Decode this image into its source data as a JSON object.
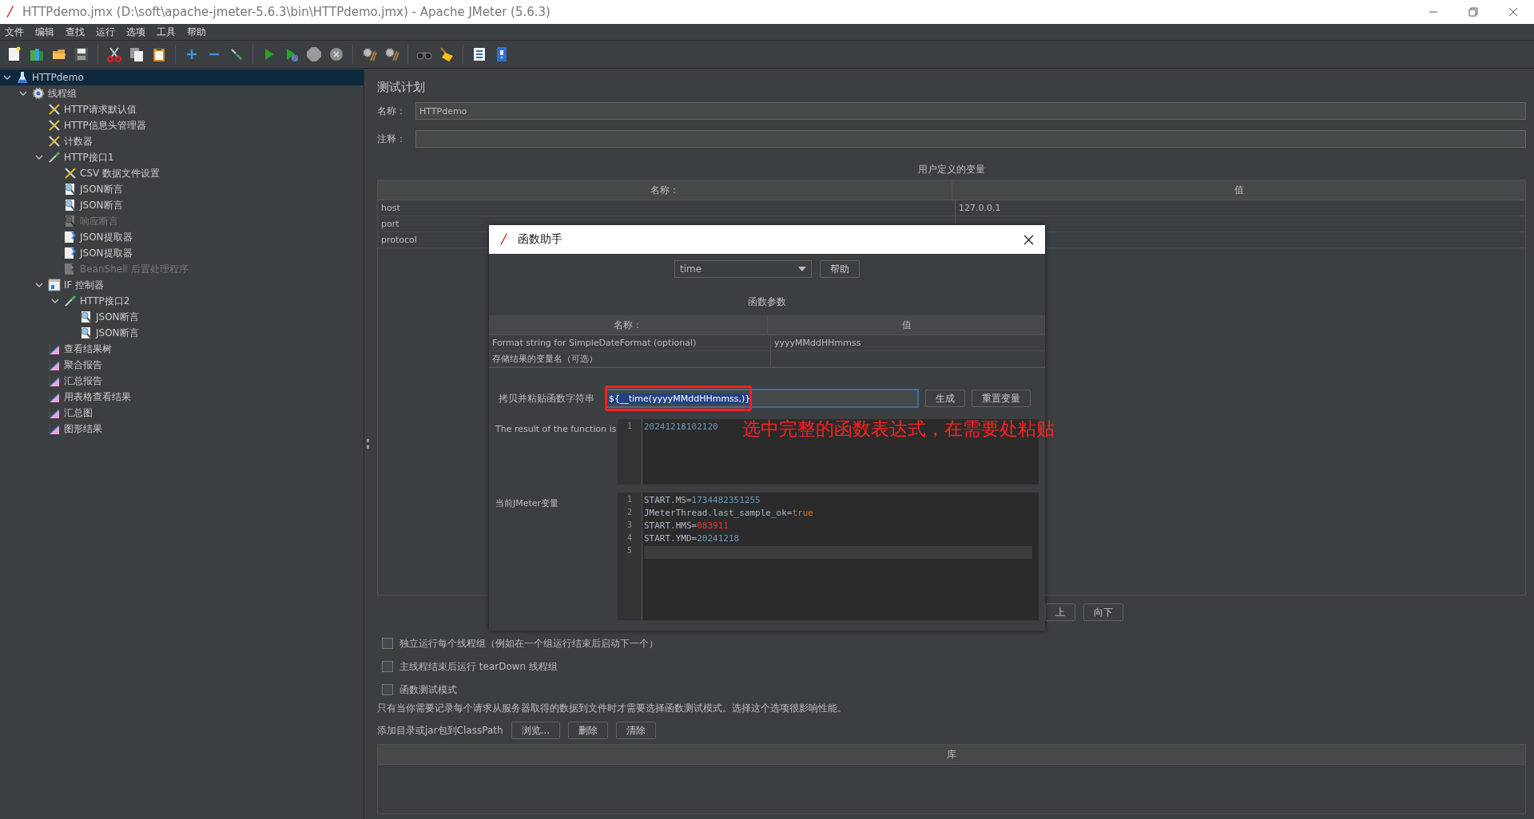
{
  "window": {
    "title": "HTTPdemo.jmx (D:\\soft\\apache-jmeter-5.6.3\\bin\\HTTPdemo.jmx) - Apache JMeter (5.6.3)"
  },
  "menu": [
    "文件",
    "编辑",
    "查找",
    "运行",
    "选项",
    "工具",
    "帮助"
  ],
  "tree": [
    {
      "label": "HTTPdemo",
      "kind": "plan",
      "selected": true,
      "disabled": false,
      "expanded": true,
      "children": [
        {
          "label": "线程组",
          "kind": "threadgroup",
          "selected": false,
          "disabled": false,
          "expanded": true,
          "children": [
            {
              "label": "HTTP请求默认值",
              "kind": "config",
              "selected": false,
              "disabled": false
            },
            {
              "label": "HTTP信息头管理器",
              "kind": "config",
              "selected": false,
              "disabled": false
            },
            {
              "label": "计数器",
              "kind": "config",
              "selected": false,
              "disabled": false
            },
            {
              "label": "HTTP接口1",
              "kind": "sampler",
              "selected": false,
              "disabled": false,
              "expanded": true,
              "children": [
                {
                  "label": "CSV 数据文件设置",
                  "kind": "config",
                  "selected": false,
                  "disabled": false
                },
                {
                  "label": "JSON断言",
                  "kind": "assertion",
                  "selected": false,
                  "disabled": false
                },
                {
                  "label": "JSON断言",
                  "kind": "assertion",
                  "selected": false,
                  "disabled": false
                },
                {
                  "label": "响应断言",
                  "kind": "assertion",
                  "selected": false,
                  "disabled": true
                },
                {
                  "label": "JSON提取器",
                  "kind": "extractor",
                  "selected": false,
                  "disabled": false
                },
                {
                  "label": "JSON提取器",
                  "kind": "extractor",
                  "selected": false,
                  "disabled": false
                },
                {
                  "label": "BeanShell 后置处理程序",
                  "kind": "extractor",
                  "selected": false,
                  "disabled": true
                }
              ]
            },
            {
              "label": "IF 控制器",
              "kind": "controller",
              "selected": false,
              "disabled": false,
              "expanded": true,
              "children": [
                {
                  "label": "HTTP接口2",
                  "kind": "sampler",
                  "selected": false,
                  "disabled": false,
                  "expanded": true,
                  "children": [
                    {
                      "label": "JSON断言",
                      "kind": "assertion",
                      "selected": false,
                      "disabled": false
                    },
                    {
                      "label": "JSON断言",
                      "kind": "assertion",
                      "selected": false,
                      "disabled": false
                    }
                  ]
                }
              ]
            },
            {
              "label": "查看结果树",
              "kind": "listener",
              "selected": false,
              "disabled": false
            },
            {
              "label": "聚合报告",
              "kind": "listener",
              "selected": false,
              "disabled": false
            },
            {
              "label": "汇总报告",
              "kind": "listener",
              "selected": false,
              "disabled": false
            },
            {
              "label": "用表格查看结果",
              "kind": "listener",
              "selected": false,
              "disabled": false
            },
            {
              "label": "汇总图",
              "kind": "listener",
              "selected": false,
              "disabled": false
            },
            {
              "label": "图形结果",
              "kind": "listener",
              "selected": false,
              "disabled": false
            }
          ]
        }
      ]
    }
  ],
  "test_plan": {
    "heading": "测试计划",
    "name_label": "名称：",
    "name_value": "HTTPdemo",
    "comment_label": "注释：",
    "variables_title": "用户定义的变量",
    "columns": [
      "名称：",
      "值"
    ],
    "rows": [
      {
        "cells": [
          "host",
          "127.0.0.1"
        ]
      },
      {
        "cells": [
          "port"
        ]
      },
      {
        "cells": [
          "protocol"
        ]
      }
    ],
    "buttons": [
      "上",
      "向下"
    ],
    "options": [
      {
        "label": "独立运行每个线程组（例如在一个组运行结束后启动下一个）",
        "checked": false
      },
      {
        "label": "主线程结束后运行 tearDown 线程组",
        "checked": false
      },
      {
        "label": "函数测试模式",
        "checked": false
      }
    ],
    "note": "只有当你需要记录每个请求从服务器取得的数据到文件时才需要选择函数测试模式。选择这个选项很影响性能。",
    "classpath_label": "添加目录或jar包到ClassPath",
    "classpath_buttons": [
      "浏览...",
      "删除",
      "清除"
    ],
    "library_column": "库"
  },
  "dialog": {
    "title": "函数助手",
    "function": "time",
    "help_button": "帮助",
    "params_title": "函数参数",
    "columns": [
      "名称：",
      "值"
    ],
    "params": [
      {
        "cells": [
          "Format string for SimpleDateFormat (optional)",
          "yyyyMMddHHmmss"
        ]
      },
      {
        "cells": [
          "存储结果的变量名（可选）"
        ]
      }
    ],
    "string_label": "拷贝并粘贴函数字符串",
    "function_string": "${__time(yyyyMMddHHmmss,)}",
    "text_selected": true,
    "buttons": [
      "生成",
      "重置变量"
    ],
    "result_label": "The result of the function is",
    "result_lines": [
      {
        "number": "1",
        "text": "20241218102120"
      }
    ],
    "vars_label": "当前JMeter变量",
    "var_lines": [
      {
        "number": "1",
        "key": "START.MS=",
        "value": "1734482351255",
        "kind": "number",
        "current": false
      },
      {
        "number": "2",
        "key": "JMeterThread.last_sample_ok=",
        "value": "true",
        "kind": "boolean",
        "current": false
      },
      {
        "number": "3",
        "key": "START.HMS=",
        "value": "083911",
        "kind": "text",
        "current": false
      },
      {
        "number": "4",
        "key": "START.YMD=",
        "value": "20241218",
        "kind": "number",
        "current": false
      },
      {
        "number": "5",
        "current": true
      }
    ]
  },
  "annotation": {
    "text": "选中完整的函数表达式，在需要处粘贴"
  }
}
